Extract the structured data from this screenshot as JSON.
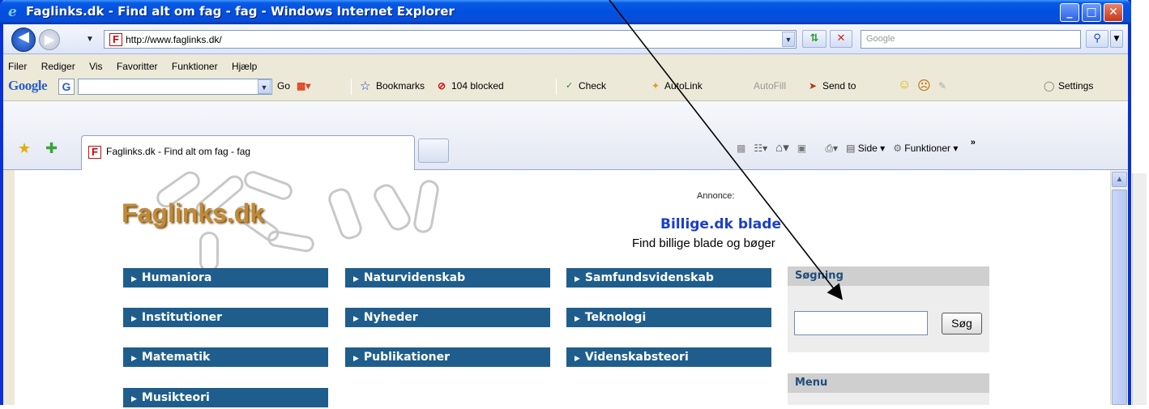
{
  "window": {
    "title": "Faglinks.dk - Find alt om fag - fag - Windows Internet Explorer",
    "buttons": {
      "minimize": "_",
      "maximize": "□",
      "close": "✕"
    }
  },
  "address": {
    "url": "http://www.faglinks.dk/",
    "search_placeholder": "Google"
  },
  "menus": [
    "Filer",
    "Rediger",
    "Vis",
    "Favoritter",
    "Funktioner",
    "Hjælp"
  ],
  "google_toolbar": {
    "logo": "Google",
    "go": "Go",
    "bookmarks": "Bookmarks",
    "blocked": "104 blocked",
    "check": "Check",
    "autolink": "AutoLink",
    "autofill": "AutoFill",
    "sendto": "Send to",
    "settings": "Settings"
  },
  "tab": {
    "title": "Faglinks.dk - Find alt om fag - fag"
  },
  "command_bar": {
    "side": "Side",
    "funktioner": "Funktioner"
  },
  "page": {
    "logo": "Faglinks.dk",
    "ad_label": "Annonce:",
    "ad_title": "Billige.dk blade",
    "ad_text": "Find billige blade og bøger",
    "categories": [
      "Humaniora",
      "Naturvidenskab",
      "Samfundsvidenskab",
      "Institutioner",
      "Nyheder",
      "Teknologi",
      "Matematik",
      "Publikationer",
      "Videnskabsteori",
      "Musikteori"
    ],
    "search_heading": "Søgning",
    "search_button": "Søg",
    "menu_heading": "Menu"
  }
}
